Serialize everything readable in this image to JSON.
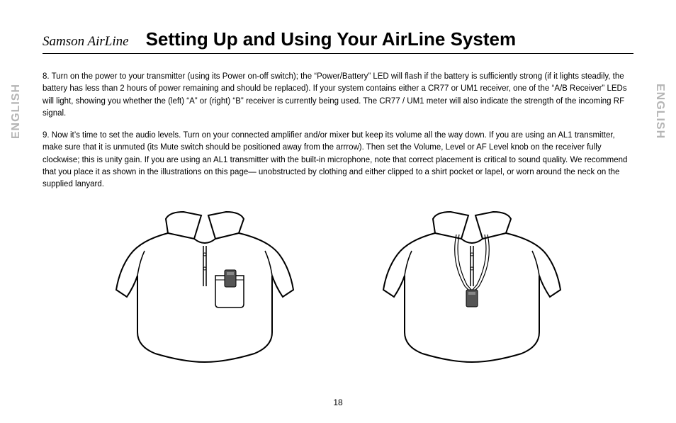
{
  "header": {
    "brand": "Samson AirLine",
    "title": "Setting Up and Using Your AirLine System"
  },
  "side_label": "ENGLISH",
  "paragraphs": {
    "p1": "8.  Turn on the power to your transmitter (using its Power on-off switch); the “Power/Battery” LED will flash if the battery is sufficiently strong (if it lights steadily, the battery has less than 2 hours of power remaining and should be replaced).  If your system contains either a CR77 or UM1 receiver, one of the “A/B Receiver” LEDs will light, showing you whether the (left) “A” or (right) “B” receiver is currently being used.  The CR77 / UM1 meter will also indicate the strength of the incoming RF signal.",
    "p2": "9.  Now it’s time to set the audio levels.  Turn on your connected amplifier and/or mixer but keep its volume all the way down.  If you are using an AL1 transmitter, make sure that it is unmuted (its Mute switch should be positioned away from the arrrow).  Then set the Volume, Level or AF Level knob on the receiver fully clockwise; this is unity gain. If you are using an AL1 transmitter with the built-in microphone, note that correct placement is critical to sound quality. We recommend that you place it as shown in the illustrations on this page—  unobstructed by clothing and either clipped to a shirt pocket or lapel, or worn around the neck on the supplied lanyard."
  },
  "figures": {
    "left_desc": "shirt-clip-illustration",
    "right_desc": "lanyard-illustration"
  },
  "page_number": "18"
}
